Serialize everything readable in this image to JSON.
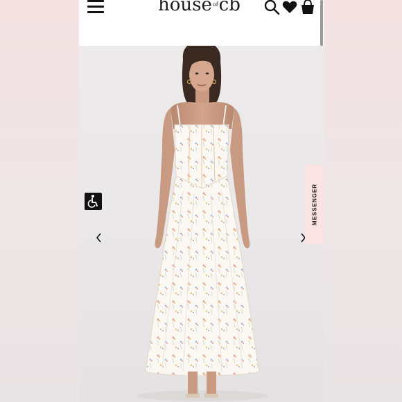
{
  "header": {
    "logo": {
      "left": "house",
      "of": "of",
      "right": "cb"
    },
    "icons": [
      "menu-icon",
      "search-icon",
      "heart-icon",
      "bag-icon"
    ]
  },
  "product": {
    "image": "model-in-white-floral-corset-maxi-dress",
    "nav": {
      "prev": "‹",
      "next": "›"
    }
  },
  "widgets": {
    "accessibility_icon": "wheelchair-icon",
    "messenger_label": "MESSENGER"
  },
  "colors": {
    "messenger_bg": "#fbe3e3",
    "accessibility_bg": "#111111"
  }
}
